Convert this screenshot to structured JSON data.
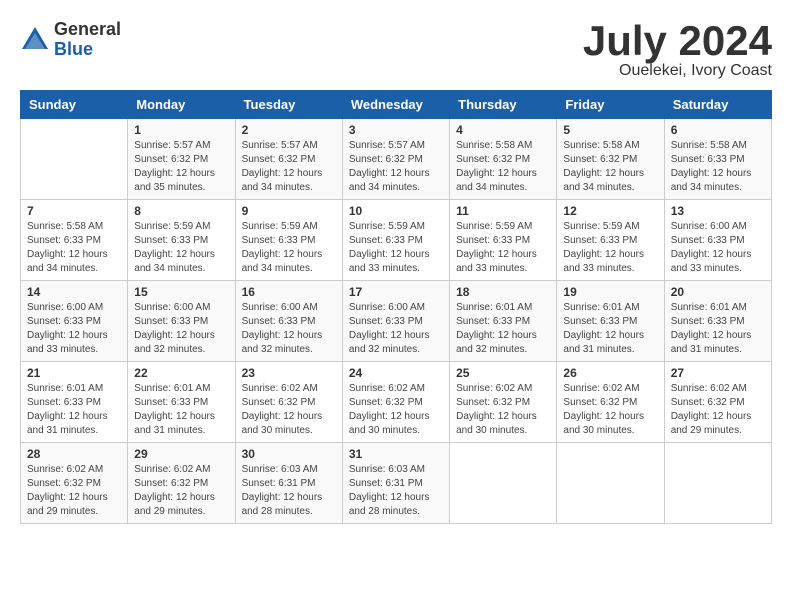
{
  "header": {
    "logo_general": "General",
    "logo_blue": "Blue",
    "month_title": "July 2024",
    "location": "Ouelekei, Ivory Coast"
  },
  "days_of_week": [
    "Sunday",
    "Monday",
    "Tuesday",
    "Wednesday",
    "Thursday",
    "Friday",
    "Saturday"
  ],
  "weeks": [
    [
      {
        "day": "",
        "empty": true
      },
      {
        "day": "1",
        "sunrise": "Sunrise: 5:57 AM",
        "sunset": "Sunset: 6:32 PM",
        "daylight": "Daylight: 12 hours and 35 minutes."
      },
      {
        "day": "2",
        "sunrise": "Sunrise: 5:57 AM",
        "sunset": "Sunset: 6:32 PM",
        "daylight": "Daylight: 12 hours and 34 minutes."
      },
      {
        "day": "3",
        "sunrise": "Sunrise: 5:57 AM",
        "sunset": "Sunset: 6:32 PM",
        "daylight": "Daylight: 12 hours and 34 minutes."
      },
      {
        "day": "4",
        "sunrise": "Sunrise: 5:58 AM",
        "sunset": "Sunset: 6:32 PM",
        "daylight": "Daylight: 12 hours and 34 minutes."
      },
      {
        "day": "5",
        "sunrise": "Sunrise: 5:58 AM",
        "sunset": "Sunset: 6:32 PM",
        "daylight": "Daylight: 12 hours and 34 minutes."
      },
      {
        "day": "6",
        "sunrise": "Sunrise: 5:58 AM",
        "sunset": "Sunset: 6:33 PM",
        "daylight": "Daylight: 12 hours and 34 minutes."
      }
    ],
    [
      {
        "day": "7",
        "sunrise": "Sunrise: 5:58 AM",
        "sunset": "Sunset: 6:33 PM",
        "daylight": "Daylight: 12 hours and 34 minutes."
      },
      {
        "day": "8",
        "sunrise": "Sunrise: 5:59 AM",
        "sunset": "Sunset: 6:33 PM",
        "daylight": "Daylight: 12 hours and 34 minutes."
      },
      {
        "day": "9",
        "sunrise": "Sunrise: 5:59 AM",
        "sunset": "Sunset: 6:33 PM",
        "daylight": "Daylight: 12 hours and 34 minutes."
      },
      {
        "day": "10",
        "sunrise": "Sunrise: 5:59 AM",
        "sunset": "Sunset: 6:33 PM",
        "daylight": "Daylight: 12 hours and 33 minutes."
      },
      {
        "day": "11",
        "sunrise": "Sunrise: 5:59 AM",
        "sunset": "Sunset: 6:33 PM",
        "daylight": "Daylight: 12 hours and 33 minutes."
      },
      {
        "day": "12",
        "sunrise": "Sunrise: 5:59 AM",
        "sunset": "Sunset: 6:33 PM",
        "daylight": "Daylight: 12 hours and 33 minutes."
      },
      {
        "day": "13",
        "sunrise": "Sunrise: 6:00 AM",
        "sunset": "Sunset: 6:33 PM",
        "daylight": "Daylight: 12 hours and 33 minutes."
      }
    ],
    [
      {
        "day": "14",
        "sunrise": "Sunrise: 6:00 AM",
        "sunset": "Sunset: 6:33 PM",
        "daylight": "Daylight: 12 hours and 33 minutes."
      },
      {
        "day": "15",
        "sunrise": "Sunrise: 6:00 AM",
        "sunset": "Sunset: 6:33 PM",
        "daylight": "Daylight: 12 hours and 32 minutes."
      },
      {
        "day": "16",
        "sunrise": "Sunrise: 6:00 AM",
        "sunset": "Sunset: 6:33 PM",
        "daylight": "Daylight: 12 hours and 32 minutes."
      },
      {
        "day": "17",
        "sunrise": "Sunrise: 6:00 AM",
        "sunset": "Sunset: 6:33 PM",
        "daylight": "Daylight: 12 hours and 32 minutes."
      },
      {
        "day": "18",
        "sunrise": "Sunrise: 6:01 AM",
        "sunset": "Sunset: 6:33 PM",
        "daylight": "Daylight: 12 hours and 32 minutes."
      },
      {
        "day": "19",
        "sunrise": "Sunrise: 6:01 AM",
        "sunset": "Sunset: 6:33 PM",
        "daylight": "Daylight: 12 hours and 31 minutes."
      },
      {
        "day": "20",
        "sunrise": "Sunrise: 6:01 AM",
        "sunset": "Sunset: 6:33 PM",
        "daylight": "Daylight: 12 hours and 31 minutes."
      }
    ],
    [
      {
        "day": "21",
        "sunrise": "Sunrise: 6:01 AM",
        "sunset": "Sunset: 6:33 PM",
        "daylight": "Daylight: 12 hours and 31 minutes."
      },
      {
        "day": "22",
        "sunrise": "Sunrise: 6:01 AM",
        "sunset": "Sunset: 6:33 PM",
        "daylight": "Daylight: 12 hours and 31 minutes."
      },
      {
        "day": "23",
        "sunrise": "Sunrise: 6:02 AM",
        "sunset": "Sunset: 6:32 PM",
        "daylight": "Daylight: 12 hours and 30 minutes."
      },
      {
        "day": "24",
        "sunrise": "Sunrise: 6:02 AM",
        "sunset": "Sunset: 6:32 PM",
        "daylight": "Daylight: 12 hours and 30 minutes."
      },
      {
        "day": "25",
        "sunrise": "Sunrise: 6:02 AM",
        "sunset": "Sunset: 6:32 PM",
        "daylight": "Daylight: 12 hours and 30 minutes."
      },
      {
        "day": "26",
        "sunrise": "Sunrise: 6:02 AM",
        "sunset": "Sunset: 6:32 PM",
        "daylight": "Daylight: 12 hours and 30 minutes."
      },
      {
        "day": "27",
        "sunrise": "Sunrise: 6:02 AM",
        "sunset": "Sunset: 6:32 PM",
        "daylight": "Daylight: 12 hours and 29 minutes."
      }
    ],
    [
      {
        "day": "28",
        "sunrise": "Sunrise: 6:02 AM",
        "sunset": "Sunset: 6:32 PM",
        "daylight": "Daylight: 12 hours and 29 minutes."
      },
      {
        "day": "29",
        "sunrise": "Sunrise: 6:02 AM",
        "sunset": "Sunset: 6:32 PM",
        "daylight": "Daylight: 12 hours and 29 minutes."
      },
      {
        "day": "30",
        "sunrise": "Sunrise: 6:03 AM",
        "sunset": "Sunset: 6:31 PM",
        "daylight": "Daylight: 12 hours and 28 minutes."
      },
      {
        "day": "31",
        "sunrise": "Sunrise: 6:03 AM",
        "sunset": "Sunset: 6:31 PM",
        "daylight": "Daylight: 12 hours and 28 minutes."
      },
      {
        "day": "",
        "empty": true
      },
      {
        "day": "",
        "empty": true
      },
      {
        "day": "",
        "empty": true
      }
    ]
  ]
}
